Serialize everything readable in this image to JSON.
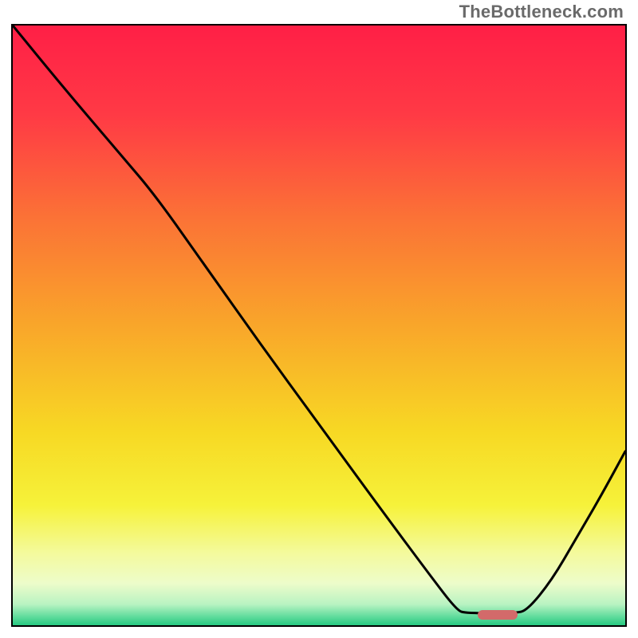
{
  "watermark": "TheBottleneck.com",
  "colors": {
    "curve": "#000000",
    "marker": "#d36a6a",
    "border": "#000000",
    "gradient_stops": [
      {
        "offset": 0.0,
        "color": "#ff1f46"
      },
      {
        "offset": 0.15,
        "color": "#ff3a45"
      },
      {
        "offset": 0.32,
        "color": "#fb7236"
      },
      {
        "offset": 0.5,
        "color": "#f9a62a"
      },
      {
        "offset": 0.68,
        "color": "#f7d924"
      },
      {
        "offset": 0.8,
        "color": "#f6f23a"
      },
      {
        "offset": 0.88,
        "color": "#f4fa9d"
      },
      {
        "offset": 0.93,
        "color": "#edfcca"
      },
      {
        "offset": 0.965,
        "color": "#b9f3c2"
      },
      {
        "offset": 0.985,
        "color": "#63dd9e"
      },
      {
        "offset": 1.0,
        "color": "#27c981"
      }
    ]
  },
  "marker": {
    "x_pct": 0.755,
    "width_pct": 0.065,
    "y_pct": 0.977
  },
  "chart_data": {
    "type": "line",
    "title": "",
    "xlabel": "",
    "ylabel": "",
    "x": [
      0.0,
      0.08,
      0.18,
      0.23,
      0.3,
      0.4,
      0.5,
      0.6,
      0.68,
      0.725,
      0.74,
      0.82,
      0.84,
      0.88,
      0.92,
      0.96,
      1.0
    ],
    "y": [
      1.0,
      0.9,
      0.78,
      0.72,
      0.62,
      0.475,
      0.335,
      0.195,
      0.085,
      0.025,
      0.02,
      0.02,
      0.025,
      0.075,
      0.145,
      0.215,
      0.29
    ],
    "xlim": [
      0,
      1
    ],
    "ylim": [
      0,
      1
    ]
  }
}
